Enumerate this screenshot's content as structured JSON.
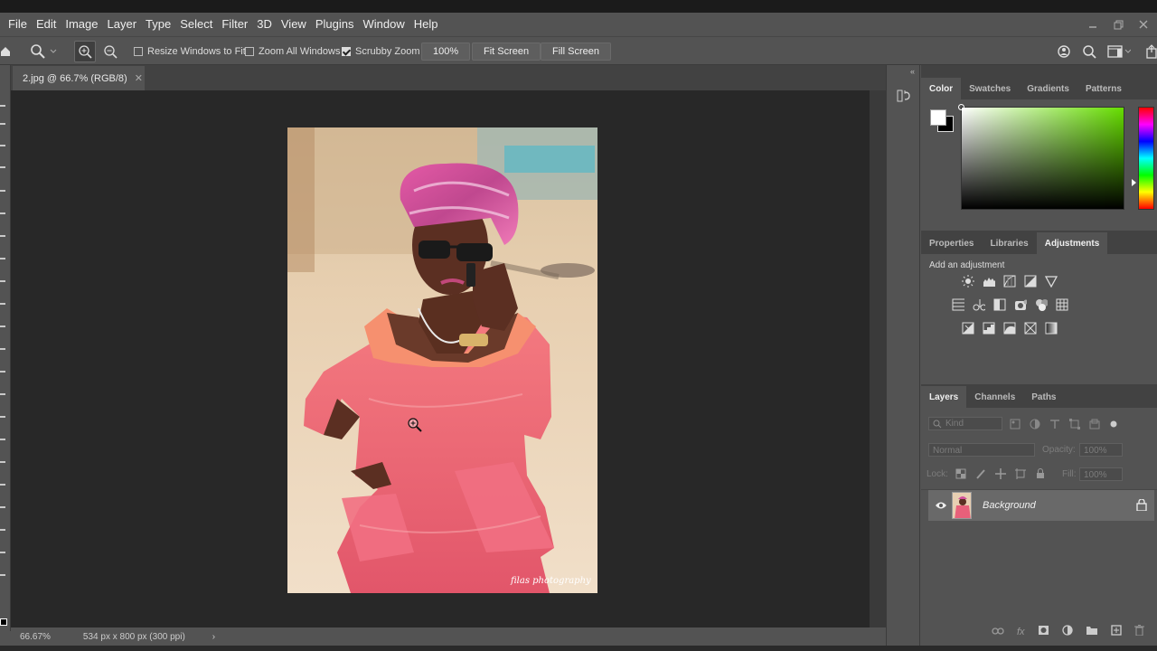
{
  "menu": {
    "items": [
      "File",
      "Edit",
      "Image",
      "Layer",
      "Type",
      "Select",
      "Filter",
      "3D",
      "View",
      "Plugins",
      "Window",
      "Help"
    ]
  },
  "options": {
    "resize_windows": "Resize Windows to Fit",
    "zoom_all": "Zoom All Windows",
    "scrubby_zoom": "Scrubby Zoom",
    "zoom_value": "100%",
    "fit_screen": "Fit Screen",
    "fill_screen": "Fill Screen",
    "resize_windows_checked": false,
    "zoom_all_checked": false,
    "scrubby_zoom_checked": true
  },
  "document": {
    "tab_title": "2.jpg @ 66.7% (RGB/8)",
    "watermark": "filas photography"
  },
  "status": {
    "zoom": "66.67%",
    "info": "534 px x 800 px (300 ppi)"
  },
  "color_panel": {
    "tabs": [
      "Color",
      "Swatches",
      "Gradients",
      "Patterns"
    ],
    "active_tab": "Color",
    "hue_color": "#66dd00",
    "foreground": "#ffffff",
    "background": "#000000"
  },
  "adjustments_panel": {
    "tabs": [
      "Properties",
      "Libraries",
      "Adjustments"
    ],
    "active_tab": "Adjustments",
    "heading": "Add an adjustment",
    "icons_row1": [
      "brightness-icon",
      "levels-icon",
      "curves-icon",
      "exposure-icon",
      "vibrance-icon"
    ],
    "icons_row2": [
      "hue-saturation-icon",
      "color-balance-icon",
      "black-white-icon",
      "photo-filter-icon",
      "channel-mixer-icon",
      "color-lookup-icon"
    ],
    "icons_row3": [
      "invert-icon",
      "posterize-icon",
      "threshold-icon",
      "selective-color-icon",
      "gradient-map-icon"
    ]
  },
  "layers_panel": {
    "tabs": [
      "Layers",
      "Channels",
      "Paths"
    ],
    "active_tab": "Layers",
    "filter_placeholder": "Kind",
    "blend_mode": "Normal",
    "opacity_label": "Opacity:",
    "opacity_value": "100%",
    "lock_label": "Lock:",
    "fill_label": "Fill:",
    "fill_value": "100%",
    "layers": [
      {
        "name": "Background",
        "visible": true,
        "locked": true
      }
    ]
  }
}
